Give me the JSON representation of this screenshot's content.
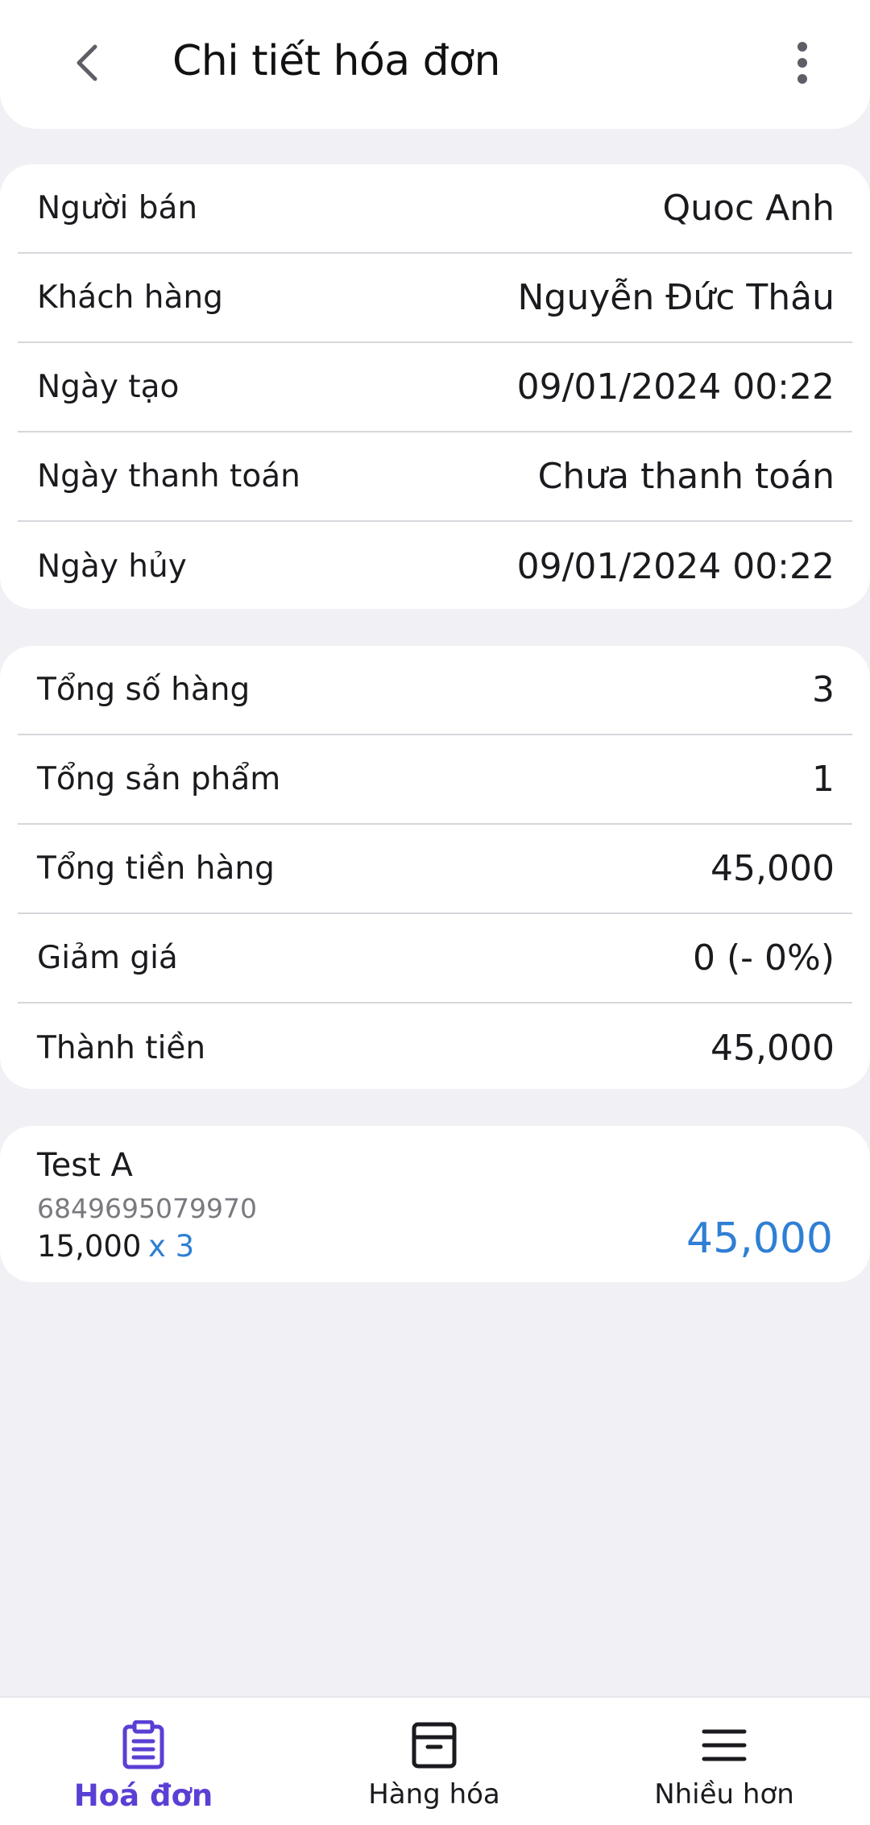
{
  "header": {
    "title": "Chi tiết hóa đơn",
    "back_icon": "chevron-left-icon",
    "more_icon": "more-vertical-icon"
  },
  "info": {
    "rows": [
      {
        "label": "Người bán",
        "value": "Quoc Anh"
      },
      {
        "label": "Khách hàng",
        "value": "Nguyễn Đức Thâu"
      },
      {
        "label": "Ngày tạo",
        "value": "09/01/2024 00:22"
      },
      {
        "label": "Ngày thanh toán",
        "value": "Chưa thanh toán"
      },
      {
        "label": "Ngày hủy",
        "value": "09/01/2024 00:22"
      }
    ]
  },
  "totals": {
    "rows": [
      {
        "label": "Tổng số hàng",
        "value": "3"
      },
      {
        "label": "Tổng sản phẩm",
        "value": "1"
      },
      {
        "label": "Tổng tiền hàng",
        "value": "45,000"
      },
      {
        "label": "Giảm giá",
        "value": "0 (- 0%)"
      },
      {
        "label": "Thành tiền",
        "value": "45,000"
      }
    ]
  },
  "item": {
    "name": "Test A",
    "code": "6849695079970",
    "unit_price": "15,000",
    "quantity": "x 3",
    "total": "45,000"
  },
  "bottom_nav": {
    "items": [
      {
        "label": "Hoá đơn",
        "icon": "clipboard-icon",
        "active": true
      },
      {
        "label": "Hàng hóa",
        "icon": "archive-box-icon",
        "active": false
      },
      {
        "label": "Nhiều hơn",
        "icon": "menu-icon",
        "active": false
      }
    ]
  },
  "colors": {
    "accent": "#5b3fd4",
    "link_blue": "#2f7fd4",
    "background": "#f1f0f4",
    "surface": "#ffffff"
  }
}
